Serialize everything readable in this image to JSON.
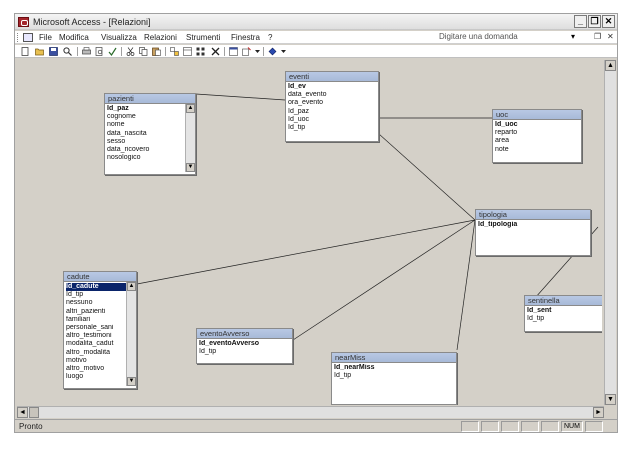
{
  "window": {
    "title": "Microsoft Access - [Relazioni]",
    "minimize": "_",
    "restore": "❐",
    "close": "✕"
  },
  "menu": {
    "items": [
      "File",
      "Modifica",
      "Visualizza",
      "Relazioni",
      "Strumenti",
      "Finestra",
      "?"
    ],
    "ask_placeholder": "Digitare una domanda",
    "ask_arrow": "▾",
    "doc_restore": "❐",
    "doc_close": "✕"
  },
  "tables": {
    "pazienti": {
      "title": "pazienti",
      "fields": [
        "Id_paz",
        "cognome",
        "nome",
        "data_nascita",
        "sesso",
        "data_ricovero",
        "nosologico"
      ]
    },
    "eventi": {
      "title": "eventi",
      "fields": [
        "Id_ev",
        "data_evento",
        "ora_evento",
        "Id_paz",
        "Id_uoc",
        "Id_tip"
      ]
    },
    "uoc": {
      "title": "uoc",
      "fields": [
        "Id_uoc",
        "reparto",
        "area",
        "note"
      ]
    },
    "tipologia": {
      "title": "tipologia",
      "fields": [
        "Id_tipologia"
      ]
    },
    "cadute": {
      "title": "cadute",
      "fields": [
        "Id_cadute",
        "Id_tip",
        "nessuno",
        "altri_pazienti",
        "familiari",
        "personale_sani",
        "altro_testimoni",
        "modalita_cadut",
        "altro_modalita",
        "motivo",
        "altro_motivo",
        "luogo"
      ]
    },
    "sentinella": {
      "title": "sentinella",
      "fields": [
        "Id_sent",
        "Id_tip"
      ]
    },
    "eventoAvverso": {
      "title": "eventoAvverso",
      "fields": [
        "Id_eventoAvverso",
        "Id_tip"
      ]
    },
    "nearMiss": {
      "title": "nearMiss",
      "fields": [
        "Id_nearMiss",
        "Id_tip"
      ]
    }
  },
  "status": {
    "text": "Pronto",
    "num": "NUM"
  }
}
